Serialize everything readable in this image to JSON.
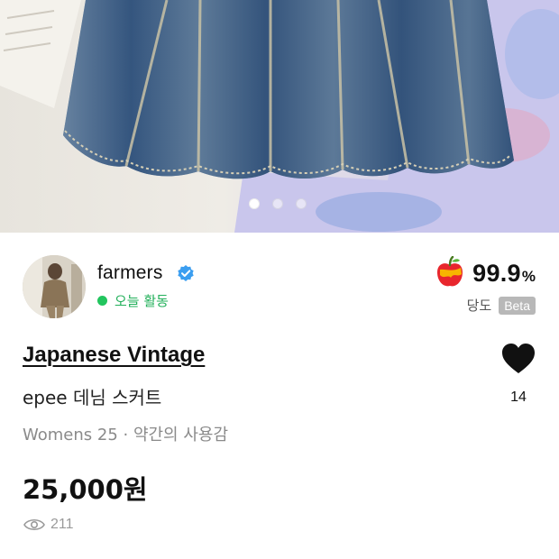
{
  "photo": {
    "alt_subject": "denim skirt",
    "carousel": {
      "total": 3,
      "active": 0
    }
  },
  "seller": {
    "name": "farmers",
    "verified_icon": "verified-check-icon",
    "activity": "오늘 활동",
    "activity_color": "#22c55e"
  },
  "rating": {
    "value": "99.9",
    "unit": "%",
    "label": "당도",
    "badge": "Beta",
    "icon": "apple-icon"
  },
  "product": {
    "brand": "Japanese Vintage",
    "title": "epee 데님 스커트",
    "details": "Womens 25 · 약간의 사용감",
    "price": "25,000원"
  },
  "like": {
    "icon": "heart-icon",
    "count": "14"
  },
  "views": {
    "icon": "eye-icon",
    "count": "211"
  }
}
